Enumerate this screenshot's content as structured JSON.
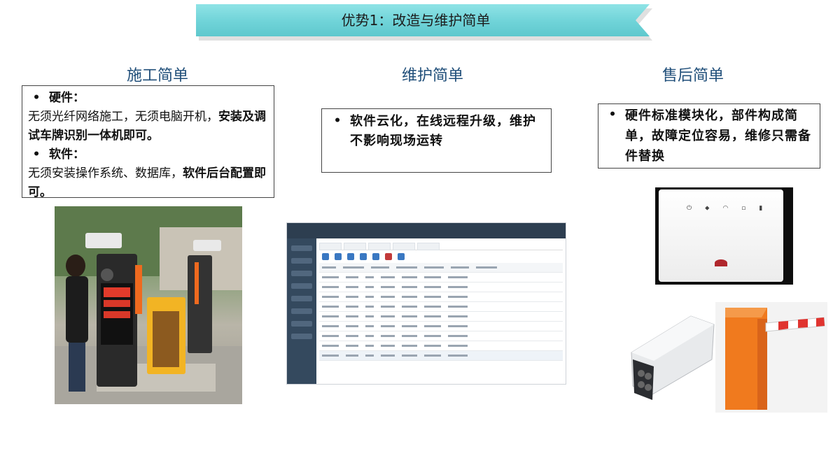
{
  "banner": {
    "title": "优势1：改造与维护简单"
  },
  "columns": [
    {
      "title": "施工简单",
      "items": [
        {
          "heading": "硬件：",
          "text_plain": "无须光纤网络施工，无须电脑开机，",
          "text_bold": "安装及调试车牌识别一体机即可。"
        },
        {
          "heading": "软件：",
          "text_plain": "无须安装操作系统、数据库，",
          "text_bold": "软件后台配置即可。"
        }
      ]
    },
    {
      "title": "维护简单",
      "items": [
        {
          "text": "软件云化，在线远程升级，维护不影响现场运转"
        }
      ]
    },
    {
      "title": "售后简单",
      "items": [
        {
          "text": "硬件标准模块化，部件构成简单，故障定位容易，维修只需备件替换"
        }
      ]
    }
  ],
  "bullet_symbol": "•"
}
